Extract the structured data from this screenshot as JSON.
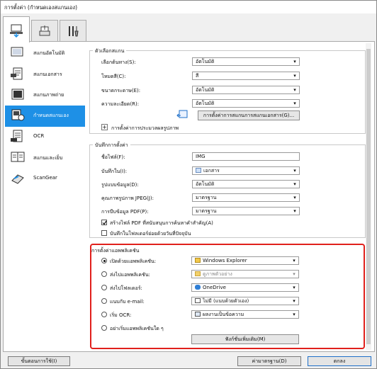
{
  "window": {
    "title": "การตั้งค่า (กำหนดเองสแกนเอง)"
  },
  "tabs": [
    {
      "icon": "scan-from-computer-icon"
    },
    {
      "icon": "scan-from-panel-icon"
    },
    {
      "icon": "general-settings-tools-icon"
    }
  ],
  "sidebar": {
    "items": [
      {
        "label": "สแกนอัตโนมัติ",
        "icon": "auto-scan-icon"
      },
      {
        "label": "สแกนเอกสาร",
        "icon": "document-scan-icon"
      },
      {
        "label": "สแกนภาพถ่าย",
        "icon": "photo-scan-icon"
      },
      {
        "label": "กำหนดสแกนเอง",
        "icon": "custom-scan-icon"
      },
      {
        "label": "OCR",
        "icon": "ocr-icon"
      },
      {
        "label": "สแกนและเย็บ",
        "icon": "scan-stitch-icon"
      },
      {
        "label": "ScanGear",
        "icon": "scangear-icon"
      }
    ]
  },
  "scan_options": {
    "title": "ตัวเลือกสแกน",
    "rows": [
      {
        "label": "เลือกต้นทาง(S):",
        "value": "อัตโนมัติ"
      },
      {
        "label": "โหมดสี(C):",
        "value": "สี"
      },
      {
        "label": "ขนาดกระดาษ(E):",
        "value": "อัตโนมัติ"
      },
      {
        "label": "ความละเอียด(R):",
        "value": "อัตโนมัติ"
      }
    ],
    "doc_settings_button": "การตั้งค่าการสแกนการสแกนเอกสาร(G)...",
    "image_processing": "การตั้งค่าการประมวลผลรูปภาพ"
  },
  "save_settings": {
    "title": "บันทึกการตั้งค่า",
    "rows": [
      {
        "label": "ชื่อไฟล์(F):",
        "value": "IMG",
        "kind": "text"
      },
      {
        "label": "บันทึกใน(I):",
        "value": "เอกสาร",
        "kind": "folder"
      },
      {
        "label": "รูปแบบข้อมูล(D):",
        "value": "อัตโนมัติ",
        "kind": "combo"
      },
      {
        "label": "คุณภาพรูปภาพ JPEG(J):",
        "value": "มาตรฐาน",
        "kind": "combo"
      },
      {
        "label": "การบีบข้อมูล PDF(P):",
        "value": "มาตรฐาน",
        "kind": "combo"
      }
    ],
    "check_pdf": "สร้างไฟล์ PDF ที่สนับสนุนการค้นหาคำสำคัญ(A)",
    "check_subfolder": "บันทึกในโฟลเดอร์ย่อยด้วยวันที่ปัจจุบัน"
  },
  "app_settings": {
    "title": "การตั้งค่าแอพพลิเคชัน",
    "rows": [
      {
        "label": "เปิดด้วยแอพพลิเคชัน:",
        "value": "Windows Explorer",
        "selected": true,
        "icon": "explorer-icon"
      },
      {
        "label": "ส่งไปแอพพลิเคชัน:",
        "value": "ดูภาพตัวอย่าง",
        "selected": false,
        "icon": "folder-icon"
      },
      {
        "label": "ส่งไปโฟลเดอร์:",
        "value": "OneDrive",
        "selected": false,
        "icon": "onedrive-icon"
      },
      {
        "label": "แนบกับ e-mail:",
        "value": "ไม่มี (แนบด้วยตัวเอง)",
        "selected": false,
        "icon": "mail-icon"
      },
      {
        "label": "เริ่ม OCR:",
        "value": "ผลงานเป็นข้อความ",
        "selected": false,
        "icon": "ocr-doc-icon"
      },
      {
        "label": "อย่าเริ่มแอพพลิเคชันใด ๆ",
        "value": "",
        "selected": false,
        "icon": ""
      }
    ],
    "more_button": "ฟังก์ชั่นเพิ่มเติม(M)"
  },
  "footer": {
    "instructions": "ขั้นตอนการใช้(I)",
    "defaults": "ค่ามาตรฐาน(D)",
    "ok": "ตกลง"
  }
}
